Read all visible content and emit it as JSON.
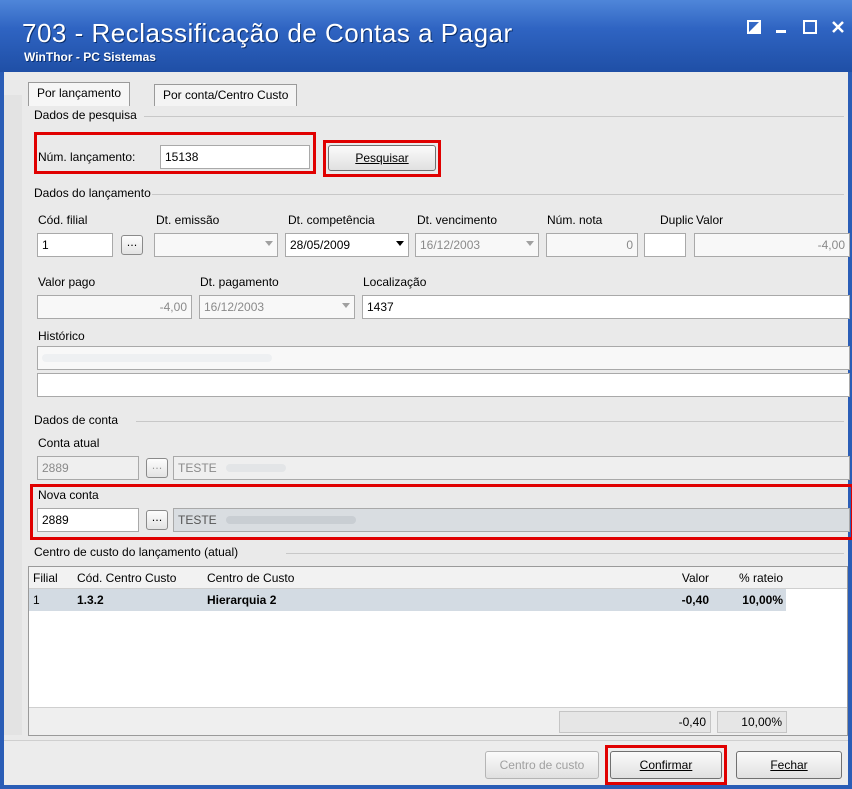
{
  "window": {
    "title": "703 - Reclassificação de Contas a Pagar",
    "subtitle": "WinThor - PC Sistemas",
    "controls": [
      "restore-icon",
      "minimize-icon",
      "maximize-icon",
      "close-icon"
    ],
    "accent_color": "#2a5db6",
    "highlight_color": "#e00000"
  },
  "tabs": [
    {
      "label": "Por lançamento",
      "active": true
    },
    {
      "label": "Por conta/Centro Custo",
      "active": false
    }
  ],
  "pesquisa": {
    "section_title": "Dados de pesquisa",
    "num_lancamento_label": "Núm. lançamento:",
    "num_lancamento_value": "15138",
    "search_button": "Pesquisar"
  },
  "lancamento": {
    "section_title": "Dados do lançamento",
    "cod_filial_label": "Cód. filial",
    "cod_filial_value": "1",
    "ellipsis": "...",
    "dt_emissao_label": "Dt. emissão",
    "dt_emissao_value": "",
    "dt_competencia_label": "Dt. competência",
    "dt_competencia_value": "28/05/2009",
    "dt_vencimento_label": "Dt. vencimento",
    "dt_vencimento_value": "16/12/2003",
    "num_nota_label": "Núm. nota",
    "num_nota_value": "0",
    "duplic_label": "Duplic",
    "duplic_value": "",
    "valor_label": "Valor",
    "valor_value": "-4,00",
    "valor_pago_label": "Valor pago",
    "valor_pago_value": "-4,00",
    "dt_pagamento_label": "Dt. pagamento",
    "dt_pagamento_value": "16/12/2003",
    "localizacao_label": "Localização",
    "localizacao_value": "1437",
    "historico_label": "Histórico",
    "historico_line1": "",
    "historico_line2": ""
  },
  "conta": {
    "section_title": "Dados de conta",
    "conta_atual_label": "Conta atual",
    "conta_atual_code": "2889",
    "conta_atual_name": "TESTE",
    "nova_conta_label": "Nova conta",
    "nova_conta_code": "2889",
    "nova_conta_name": "TESTE"
  },
  "centro_custo": {
    "section_title": "Centro de custo do lançamento (atual)",
    "columns": [
      "Filial",
      "Cód. Centro Custo",
      "Centro de Custo",
      "Valor",
      "% rateio"
    ],
    "rows": [
      {
        "filial": "1",
        "cod": "1.3.2",
        "centro": "Hierarquia 2",
        "valor": "-0,40",
        "rateio": "10,00%"
      }
    ],
    "total_valor": "-0,40",
    "total_rateio": "10,00%"
  },
  "footer": {
    "centro_custo_button": "Centro de custo",
    "confirmar_button": "Confirmar",
    "fechar_button": "Fechar"
  }
}
